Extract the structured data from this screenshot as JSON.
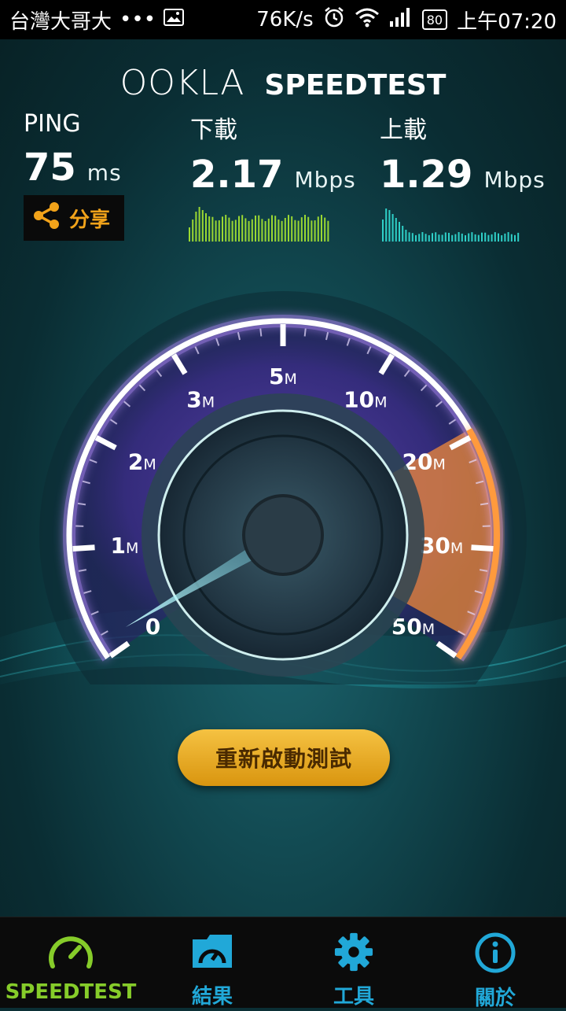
{
  "status_bar": {
    "carrier": "台灣大哥大",
    "dots": "•••",
    "speed": "76K/s",
    "battery": "80",
    "time": "上午07:20"
  },
  "brand": {
    "logo_left": "OOKLA",
    "logo_right": "SPEEDTEST"
  },
  "metrics": {
    "ping": {
      "label": "PING",
      "value": "75",
      "unit": "ms"
    },
    "download": {
      "label": "下載",
      "value": "2.17",
      "unit": "Mbps"
    },
    "upload": {
      "label": "上載",
      "value": "1.29",
      "unit": "Mbps"
    }
  },
  "share": {
    "label": "分享",
    "icon": "share-icon"
  },
  "gauge": {
    "ticks": [
      "0",
      "1",
      "2",
      "3",
      "5",
      "10",
      "20",
      "30",
      "50"
    ],
    "unit_suffix": "M",
    "needle_value_mbps": 0.15,
    "colors": {
      "ring": "#ffffff",
      "glow": "#b58cff",
      "hot": "#f08a3a"
    }
  },
  "restart_button": {
    "label": "重新啟動測試"
  },
  "nav": {
    "items": [
      {
        "label": "SPEEDTEST",
        "icon": "speedometer-icon",
        "active": true
      },
      {
        "label": "結果",
        "icon": "results-folder-icon",
        "active": false
      },
      {
        "label": "工具",
        "icon": "gear-icon",
        "active": false
      },
      {
        "label": "關於",
        "icon": "info-icon",
        "active": false
      }
    ]
  },
  "colors": {
    "accent_green": "#86cc2a",
    "accent_blue": "#21a8d8",
    "accent_orange": "#f2a31a",
    "download_spark": "#9bd832",
    "upload_spark": "#2fd0c8"
  }
}
